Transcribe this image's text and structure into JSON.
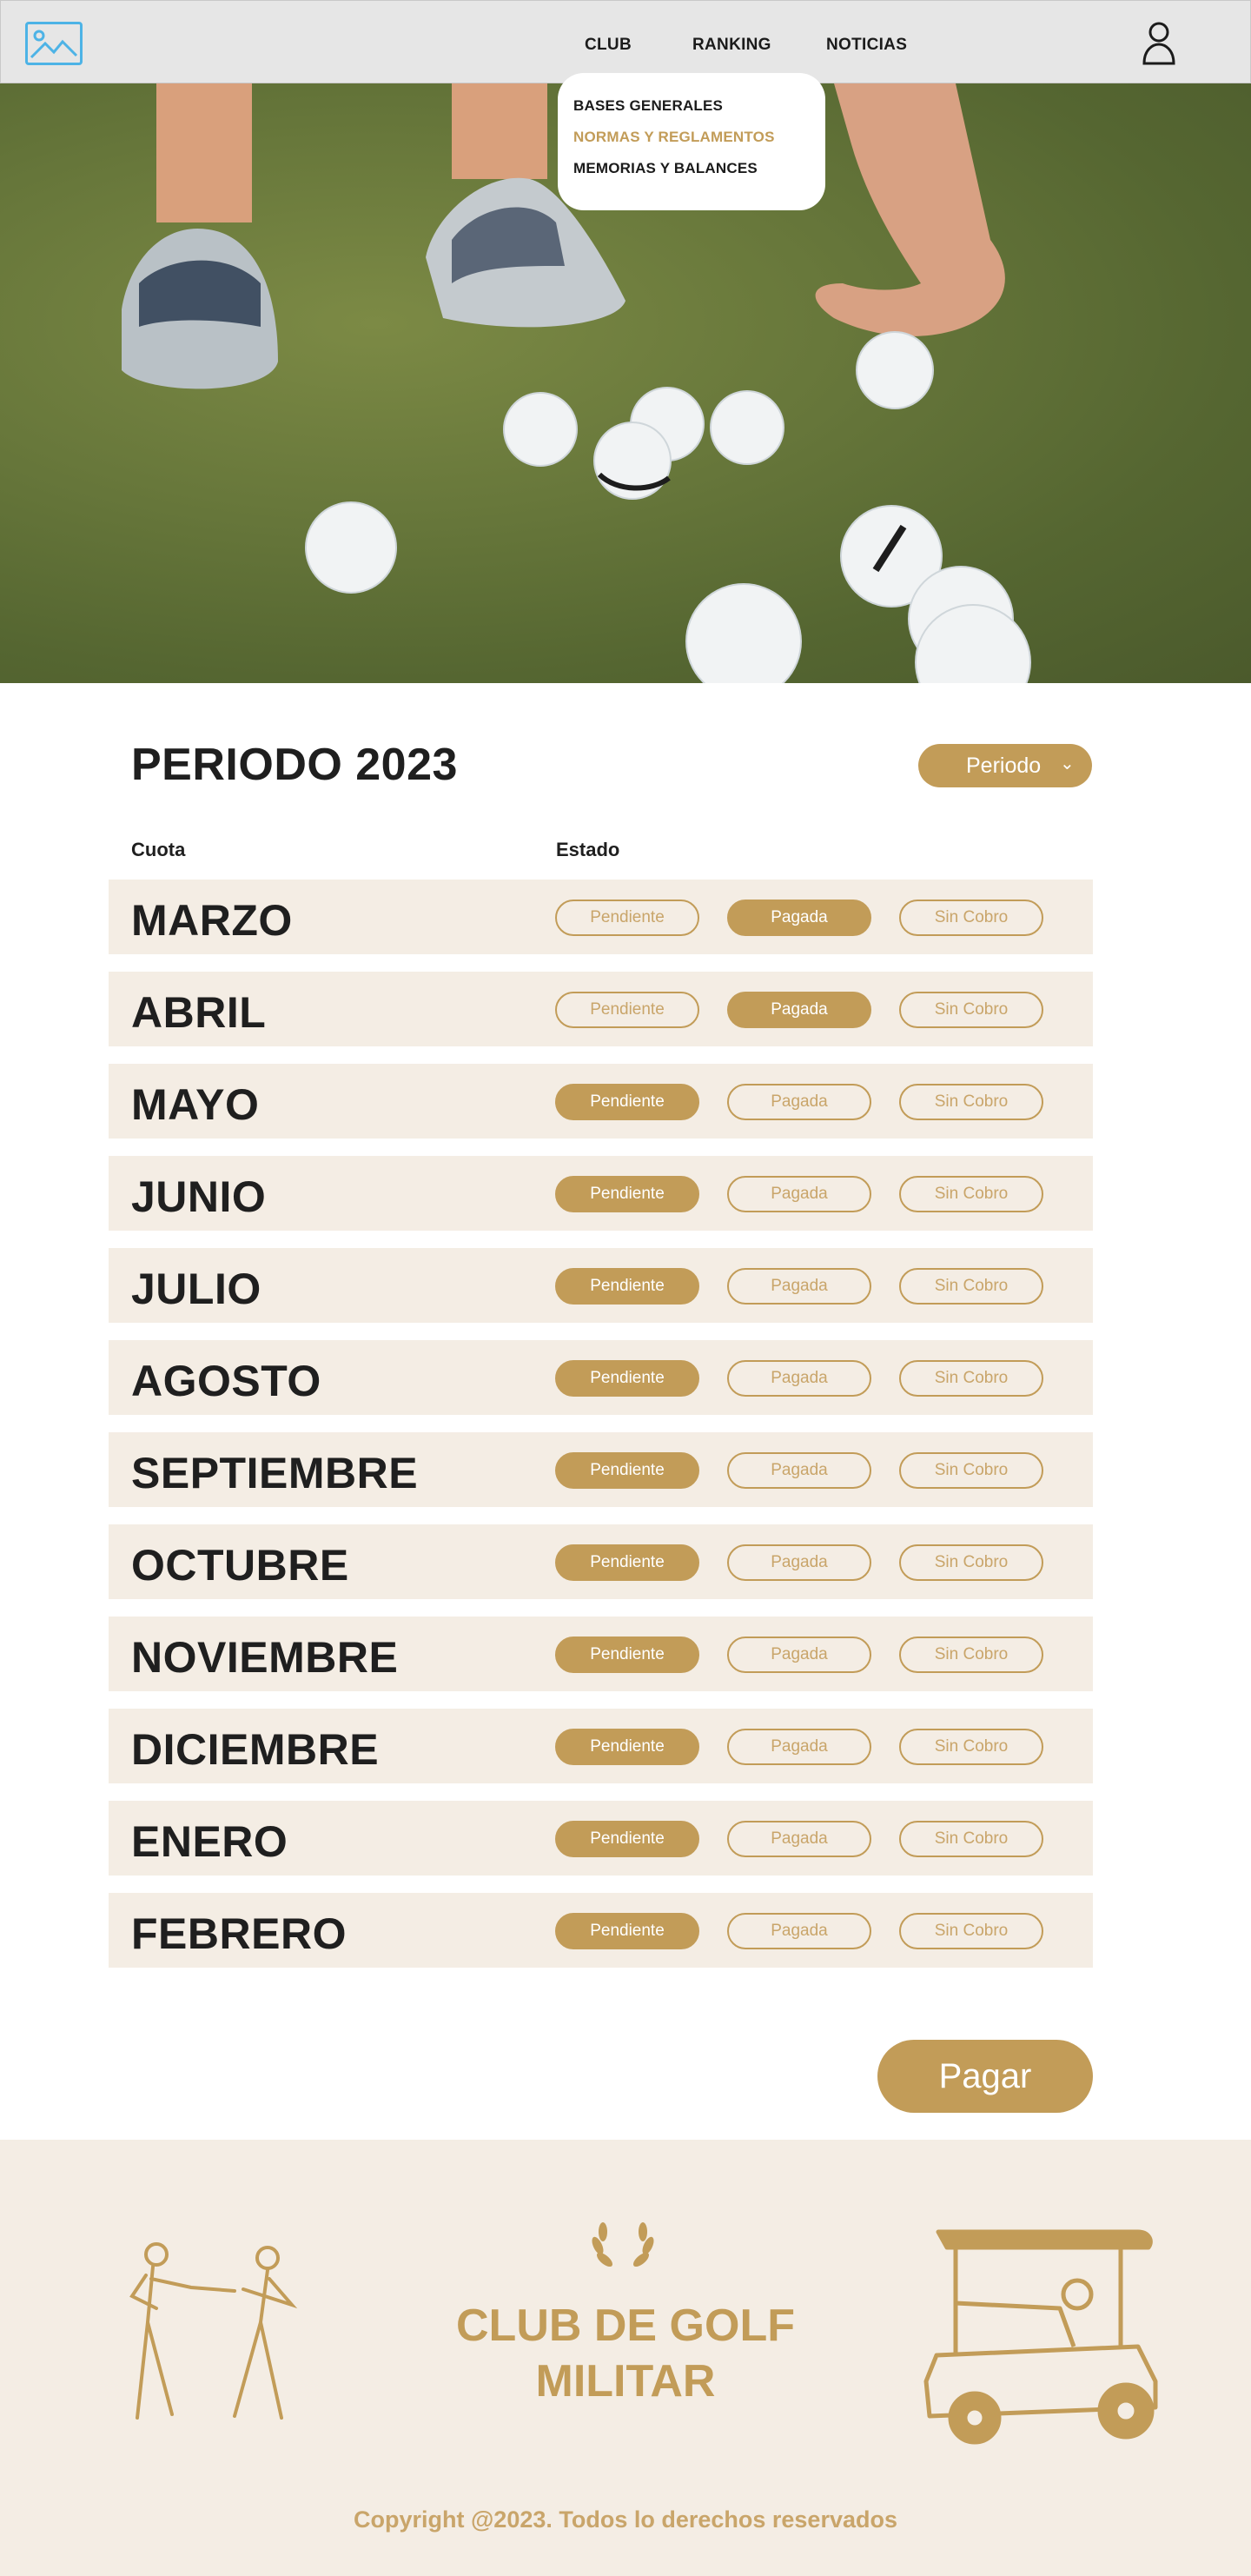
{
  "nav": {
    "club": "CLUB",
    "ranking": "RANKING",
    "news": "NOTICIAS"
  },
  "club_menu": [
    "BASES GENERALES",
    "NORMAS Y REGLAMENTOS",
    "MEMORIAS Y BALANCES"
  ],
  "period": {
    "title": "PERIODO 2023",
    "select_label": "Periodo",
    "chevron": "⌄"
  },
  "table": {
    "headers": {
      "cuota": "Cuota",
      "estado": "Estado"
    },
    "status_options": [
      "Pendiente",
      "Pagada",
      "Sin Cobro"
    ],
    "rows": [
      {
        "month": "MARZO",
        "selected": "Pagada"
      },
      {
        "month": "ABRIL",
        "selected": "Pagada"
      },
      {
        "month": "MAYO",
        "selected": "Pendiente"
      },
      {
        "month": "JUNIO",
        "selected": "Pendiente"
      },
      {
        "month": "JULIO",
        "selected": "Pendiente"
      },
      {
        "month": "AGOSTO",
        "selected": "Pendiente"
      },
      {
        "month": "SEPTIEMBRE",
        "selected": "Pendiente"
      },
      {
        "month": "OCTUBRE",
        "selected": "Pendiente"
      },
      {
        "month": "NOVIEMBRE",
        "selected": "Pendiente"
      },
      {
        "month": "DICIEMBRE",
        "selected": "Pendiente"
      },
      {
        "month": "ENERO",
        "selected": "Pendiente"
      },
      {
        "month": "FEBRERO",
        "selected": "Pendiente"
      }
    ]
  },
  "pay_button": "Pagar",
  "footer": {
    "brand_line1": "CLUB DE GOLF",
    "brand_line2": "MILITAR",
    "copyright": "Copyright @2023. Todos lo derechos reservados"
  },
  "colors": {
    "accent": "#c29c58",
    "row_bg": "#f4ede4",
    "header_bg": "#e6e6e6",
    "logo": "#4db3e6"
  },
  "icons": {
    "logo": "image-placeholder-icon",
    "user": "user-icon",
    "laurel": "laurel-icon"
  }
}
